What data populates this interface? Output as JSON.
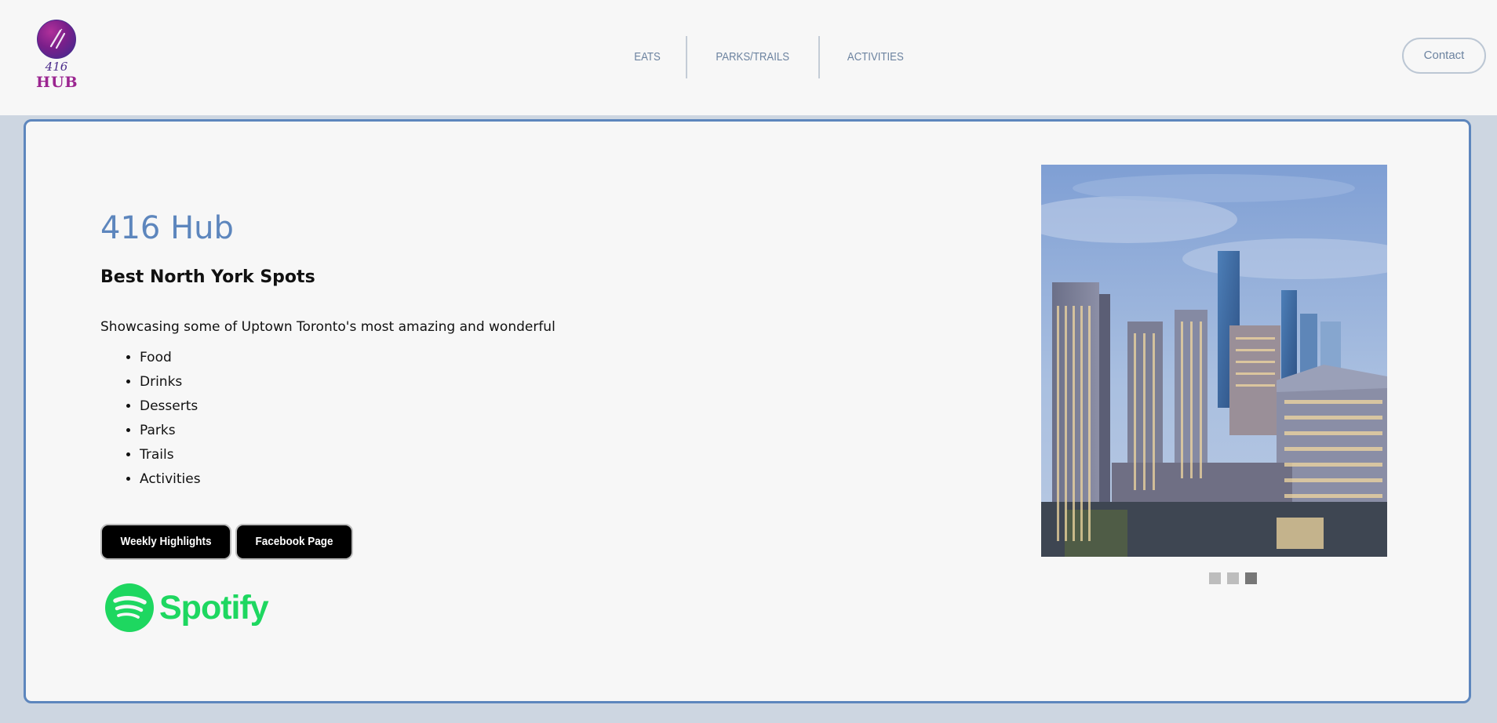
{
  "header": {
    "logo": {
      "number": "416",
      "word": "HUB"
    },
    "nav": [
      {
        "label": "EATS"
      },
      {
        "label": "PARKS/TRAILS"
      },
      {
        "label": "ACTIVITIES"
      }
    ],
    "contact_label": "Contact"
  },
  "hero": {
    "title": "416 Hub",
    "subtitle": "Best North York Spots",
    "description": "Showcasing some of Uptown Toronto's most amazing and wonderful",
    "items": [
      "Food",
      "Drinks",
      "Desserts",
      "Parks",
      "Trails",
      "Activities"
    ],
    "buttons": {
      "weekly": "Weekly Highlights",
      "facebook": "Facebook Page"
    },
    "spotify_label": "Spotify"
  },
  "carousel": {
    "slides_count": 3,
    "active_slide": 3
  },
  "colors": {
    "accent": "#5d86bd",
    "page_bg": "#cdd6e1",
    "spotify": "#1ed760"
  }
}
